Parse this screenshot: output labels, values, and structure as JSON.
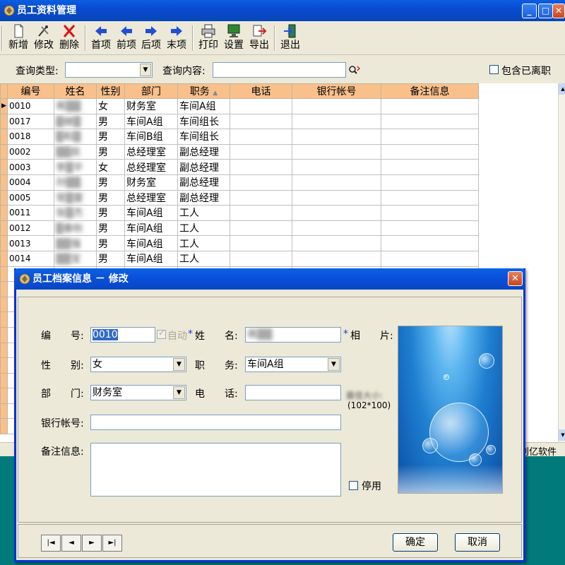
{
  "window": {
    "title": "员工资料管理"
  },
  "toolbar": {
    "add": "新增",
    "edit": "修改",
    "delete": "删除",
    "first": "首项",
    "prev": "前项",
    "next": "后项",
    "last": "末项",
    "print": "打印",
    "settings": "设置",
    "export": "导出",
    "exit": "退出"
  },
  "search": {
    "type_label": "查询类型:",
    "type_value": "",
    "content_label": "查询内容:",
    "content_value": "",
    "include_resigned_label": "包含已离职",
    "include_resigned_checked": false
  },
  "grid": {
    "columns": [
      "编号",
      "姓名",
      "性别",
      "部门",
      "职务",
      "电话",
      "银行帐号",
      "备注信息"
    ],
    "rows": [
      [
        "0010",
        "蒋▒▒",
        "女",
        "财务室",
        "车间A组",
        "",
        "",
        ""
      ],
      [
        "0017",
        "▒继▒",
        "男",
        "车间A组",
        "车间组长",
        "",
        "",
        ""
      ],
      [
        "0018",
        "▒和▒",
        "男",
        "车间B组",
        "车间组长",
        "",
        "",
        ""
      ],
      [
        "0002",
        "▒▒民",
        "男",
        "总经理室",
        "副总经理",
        "",
        "",
        ""
      ],
      [
        "0003",
        "李▒平",
        "女",
        "总经理室",
        "副总经理",
        "",
        "",
        ""
      ],
      [
        "0004",
        "孙▒▒",
        "男",
        "财务室",
        "副总经理",
        "",
        "",
        ""
      ],
      [
        "0005",
        "常▒雷",
        "男",
        "总经理室",
        "副总经理",
        "",
        "",
        ""
      ],
      [
        "0011",
        "张▒杰",
        "男",
        "车间A组",
        "工人",
        "",
        "",
        ""
      ],
      [
        "0012",
        "▒春秋",
        "男",
        "车间A组",
        "工人",
        "",
        "",
        ""
      ],
      [
        "0013",
        "▒▒强",
        "男",
        "车间A组",
        "工人",
        "",
        "",
        ""
      ],
      [
        "0014",
        "▒▒宝",
        "男",
        "车间A组",
        "工人",
        "",
        "",
        ""
      ]
    ],
    "sort_indicator": "▲"
  },
  "status": {
    "right_text": "创亿软件"
  },
  "dialog": {
    "title": "员工档案信息 － 修改",
    "fields": {
      "id_label": "编　　号:",
      "id_value": "0010",
      "auto_label": "自动",
      "name_label": "姓　　名:",
      "name_value": "蒋▒▒",
      "photo_label": "相　　片:",
      "gender_label": "性　　别:",
      "gender_value": "女",
      "position_label": "职　　务:",
      "position_value": "车间A组",
      "dept_label": "部　　门:",
      "dept_value": "财务室",
      "phone_label": "电　　话:",
      "phone_value": "",
      "photo_size_label": "最佳大小:",
      "photo_size_value": "(102*100)",
      "bank_label": "银行帐号:",
      "bank_value": "",
      "notes_label": "备注信息:",
      "notes_value": "",
      "disabled_label": "停用",
      "disabled_checked": false
    },
    "buttons": {
      "ok": "确定",
      "cancel": "取消"
    },
    "nav": {
      "first": "|◄",
      "prev": "◄",
      "next": "►",
      "last": "►|"
    }
  },
  "colors": {
    "title_blue": "#0a4bd1",
    "header_orange": "#f9c08c",
    "bg": "#ece9d8"
  }
}
